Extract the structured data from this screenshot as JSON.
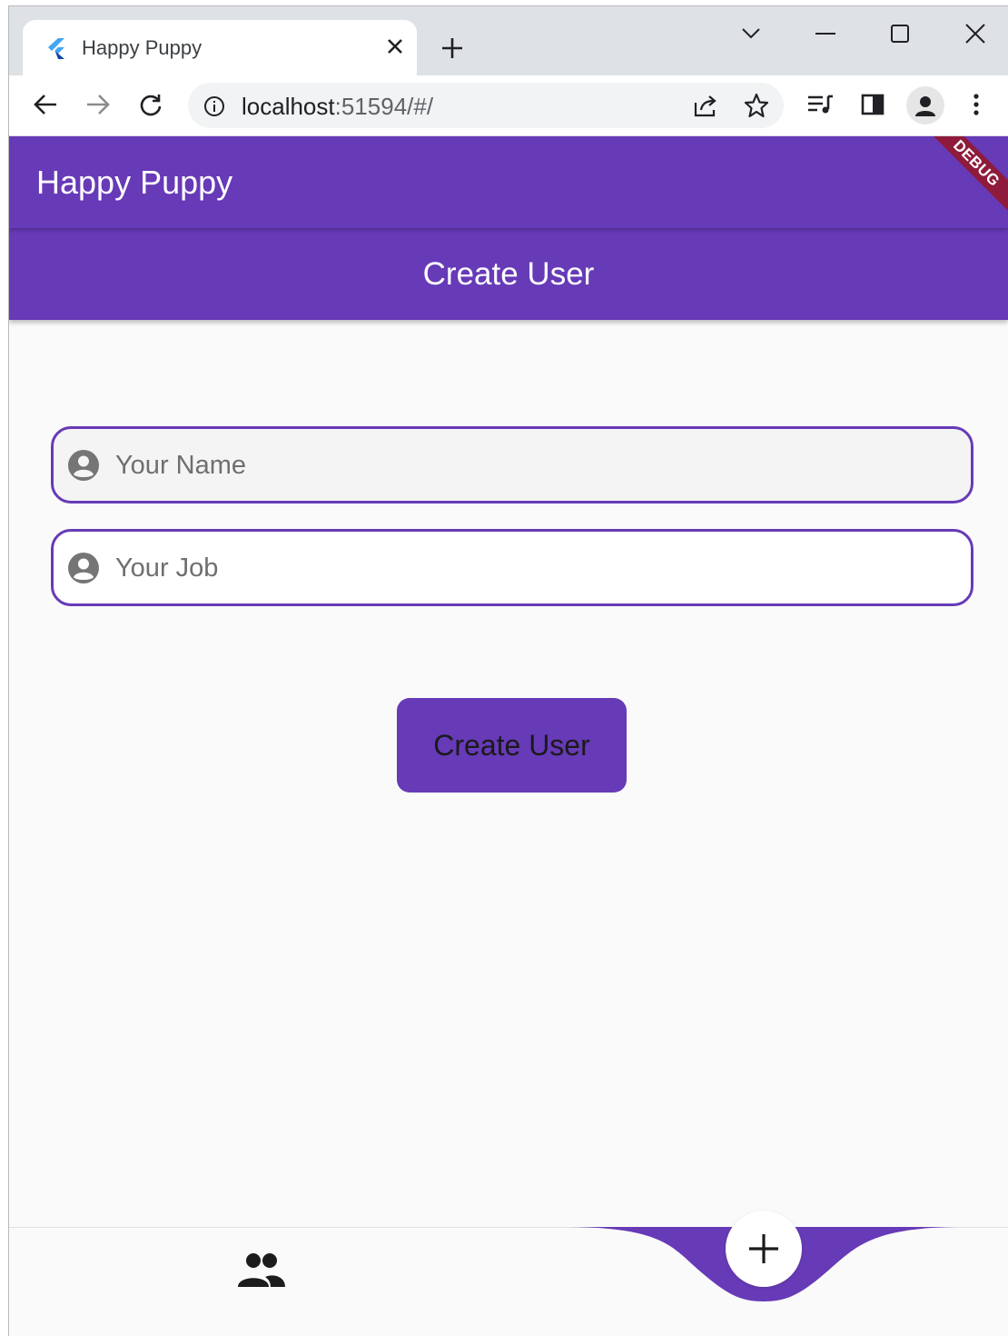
{
  "browser": {
    "tab": {
      "title": "Happy Puppy"
    },
    "url": {
      "host": "localhost",
      "rest": ":51594/#/"
    }
  },
  "app": {
    "title": "Happy Puppy",
    "debug_banner": "DEBUG",
    "page_title": "Create User",
    "form": {
      "name_placeholder": "Your Name",
      "job_placeholder": "Your Job",
      "submit_label": "Create User"
    },
    "bottom_nav": {
      "items": [
        {
          "icon": "users-icon"
        },
        {
          "icon": "plus-icon"
        }
      ]
    }
  },
  "colors": {
    "primary": "#673ab7",
    "debug": "#8e1b3c",
    "background": "#fafafa"
  }
}
